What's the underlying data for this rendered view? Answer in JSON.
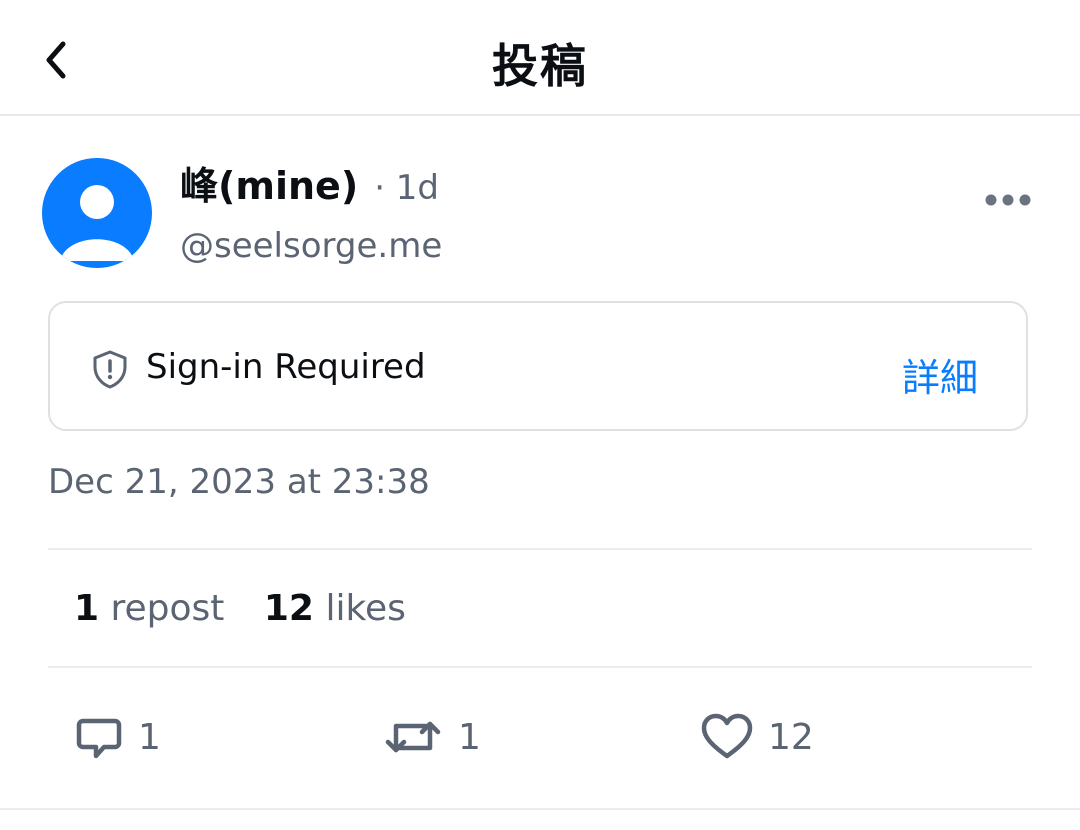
{
  "header": {
    "title": "投稿",
    "back_icon": "chevron-left-icon"
  },
  "post": {
    "author": {
      "display_name": "峰(mine)",
      "handle": "@seelsorge.me",
      "avatar_icon": "default-avatar-icon",
      "avatar_color": "#0a7cff"
    },
    "time_ago": "· 1d",
    "more_icon": "more-horizontal-icon",
    "notice": {
      "icon": "shield-exclamation-icon",
      "text": "Sign-in Required",
      "link_label": "詳細"
    },
    "timestamp": "Dec 21, 2023 at 23:38",
    "stats": {
      "reposts_count": "1",
      "reposts_label": "repost",
      "likes_count": "12",
      "likes_label": "likes"
    },
    "actions": {
      "reply_count": "1",
      "repost_count": "1",
      "like_count": "12"
    }
  },
  "colors": {
    "accent": "#0a7cff",
    "muted_text": "#5b6472",
    "divider": "#ecebee"
  }
}
